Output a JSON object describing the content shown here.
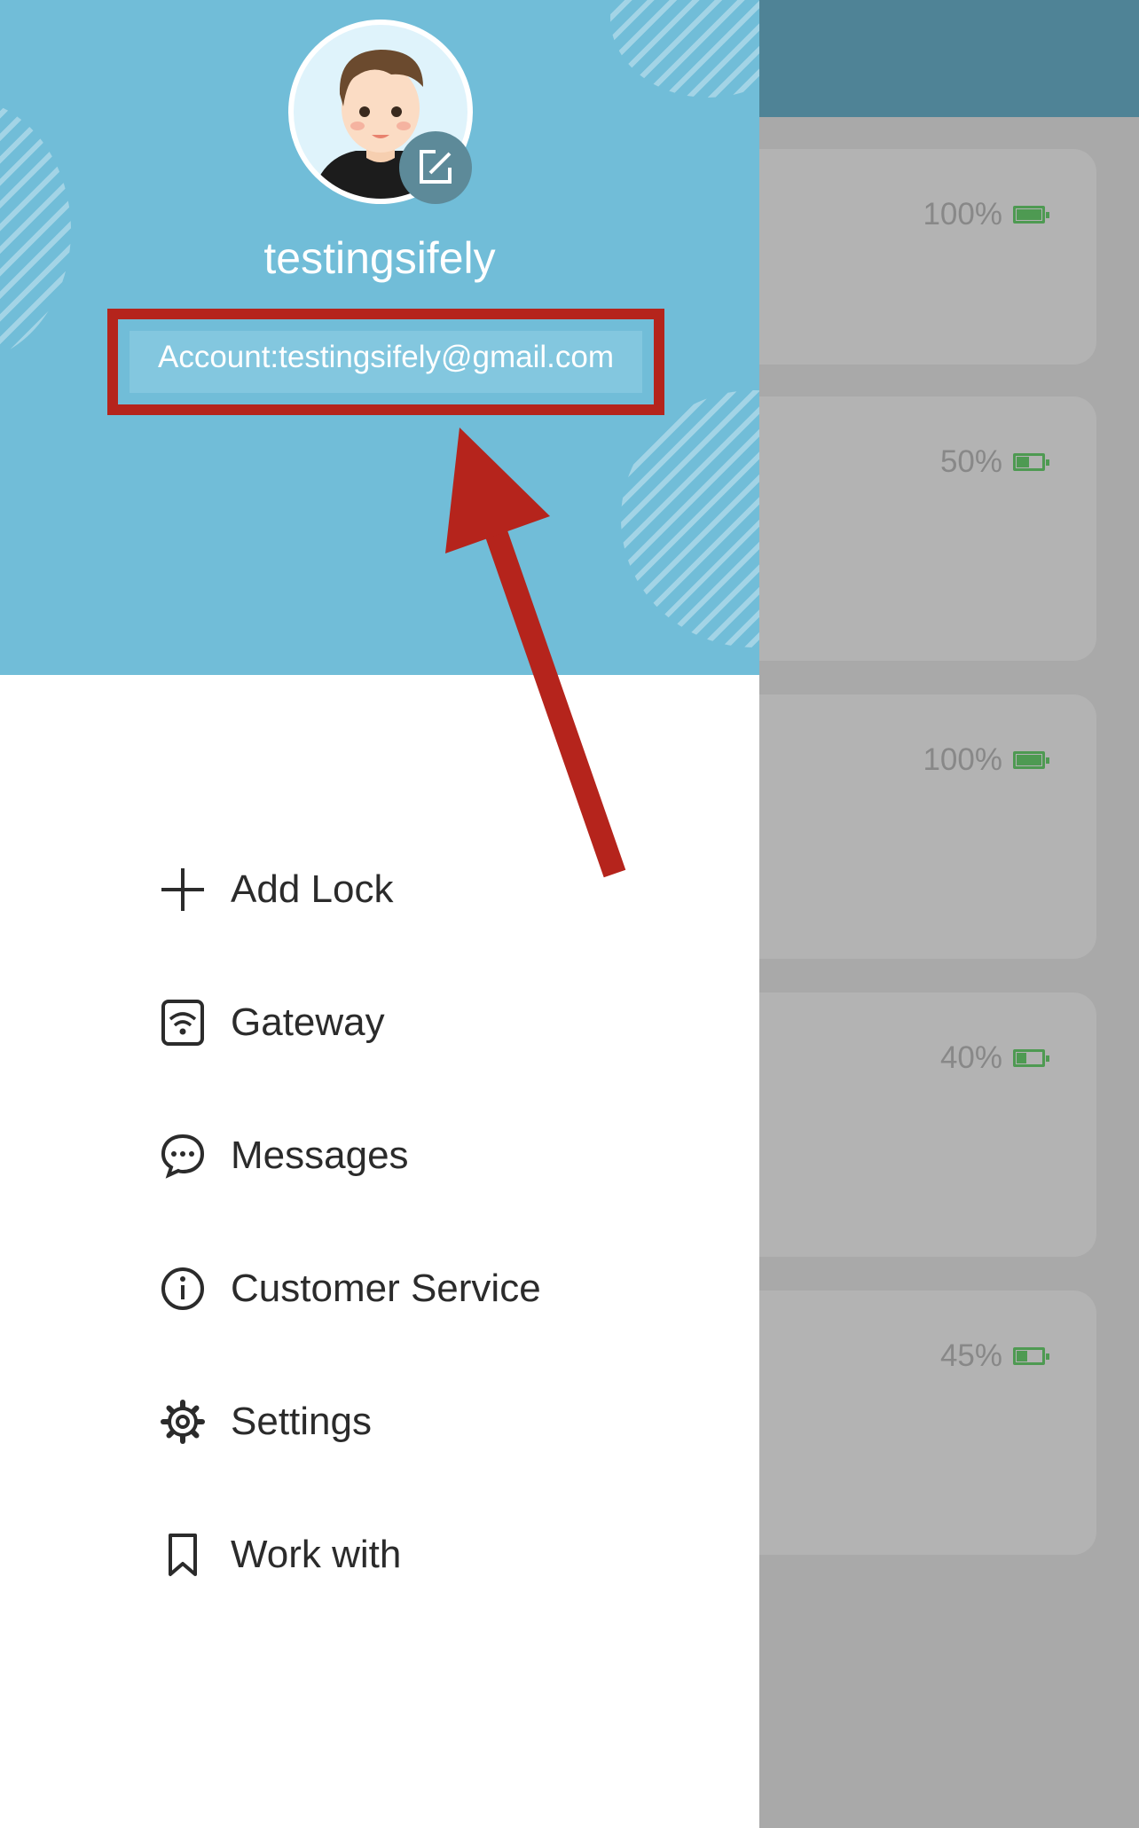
{
  "profile": {
    "username": "testingsifely",
    "account": "Account:testingsifely@gmail.com"
  },
  "menu": {
    "items": [
      {
        "label": "Add Lock",
        "icon": "plus-icon"
      },
      {
        "label": "Gateway",
        "icon": "gateway-wifi-icon"
      },
      {
        "label": "Messages",
        "icon": "chat-bubble-icon"
      },
      {
        "label": "Customer Service",
        "icon": "info-icon"
      },
      {
        "label": "Settings",
        "icon": "gear-icon"
      },
      {
        "label": "Work with",
        "icon": "bookmark-icon"
      }
    ]
  },
  "locks": [
    {
      "battery": "100%",
      "level": 1.0
    },
    {
      "battery": "50%",
      "level": 0.5
    },
    {
      "battery": "100%",
      "level": 1.0
    },
    {
      "battery": "40%",
      "level": 0.4
    },
    {
      "battery": "45%",
      "level": 0.45
    }
  ],
  "colors": {
    "header": "#71bdd8",
    "annotation": "#b5241c",
    "battery": "#4e9a52",
    "topbar": "#4f8396"
  }
}
